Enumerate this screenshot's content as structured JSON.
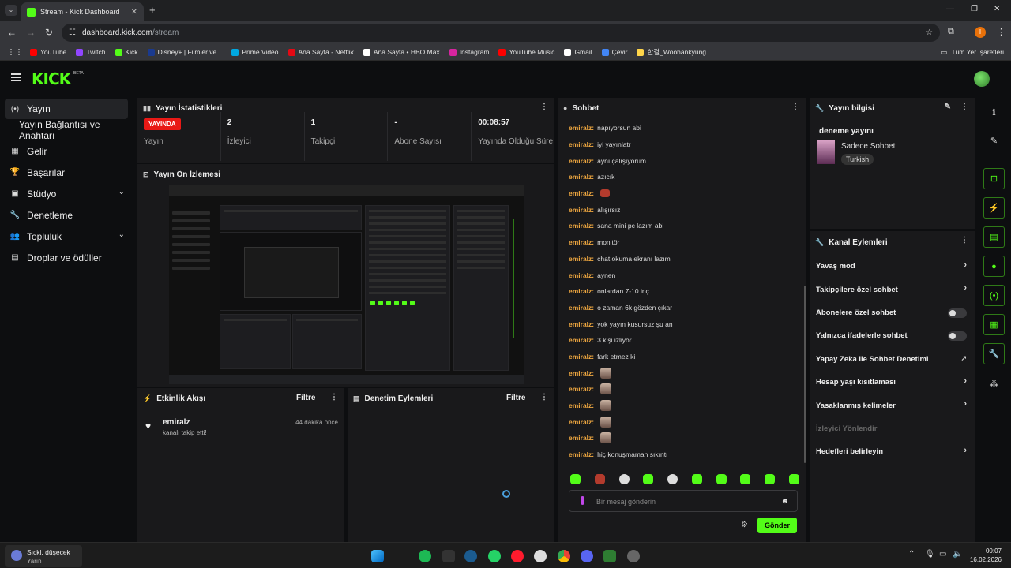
{
  "browser": {
    "tab_title": "Stream - Kick Dashboard",
    "url_host": "dashboard.kick.com",
    "url_path": "/stream",
    "profile_initial": "I",
    "bookmarks": [
      {
        "label": "YouTube",
        "color": "#ff0000"
      },
      {
        "label": "Twitch",
        "color": "#9146ff"
      },
      {
        "label": "Kick",
        "color": "#53fc18"
      },
      {
        "label": "Disney+ | Filmler ve...",
        "color": "#1a3a8f"
      },
      {
        "label": "Prime Video",
        "color": "#00a8e1"
      },
      {
        "label": "Ana Sayfa - Netflix",
        "color": "#e50914"
      },
      {
        "label": "Ana Sayfa • HBO Max",
        "color": "#ffffff"
      },
      {
        "label": "Instagram",
        "color": "#d6249f"
      },
      {
        "label": "YouTube Music",
        "color": "#ff0000"
      },
      {
        "label": "Gmail",
        "color": "#ffffff"
      },
      {
        "label": "Çevir",
        "color": "#4285f4"
      },
      {
        "label": "한결_Woohankyung...",
        "color": "#ffd54a"
      }
    ],
    "all_bookmarks": "Tüm Yer İşaretleri"
  },
  "app": {
    "logo": "KICK",
    "beta": "BETA"
  },
  "sidebar": {
    "items": [
      {
        "label": "Yayın",
        "icon": "(•)",
        "active": true
      },
      {
        "label": "Yayın Bağlantısı ve Anahtarı",
        "icon": ""
      },
      {
        "label": "Gelir",
        "icon": "▦"
      },
      {
        "label": "Başarılar",
        "icon": "🏆"
      },
      {
        "label": "Stüdyo",
        "icon": "▣",
        "chevron": true
      },
      {
        "label": "Denetleme",
        "icon": "🔧"
      },
      {
        "label": "Topluluk",
        "icon": "👥",
        "chevron": true
      },
      {
        "label": "Droplar ve ödüller",
        "icon": "▤"
      }
    ]
  },
  "stats": {
    "title": "Yayın İstatistikleri",
    "live_badge": "YAYINDA",
    "items": [
      {
        "value": "",
        "label": "Yayın"
      },
      {
        "value": "2",
        "label": "İzleyici"
      },
      {
        "value": "1",
        "label": "Takipçi"
      },
      {
        "value": "-",
        "label": "Abone Sayısı"
      },
      {
        "value": "00:08:57",
        "label": "Yayında Olduğu Süre"
      }
    ]
  },
  "preview": {
    "title": "Yayın Ön İzlemesi"
  },
  "activity": {
    "title": "Etkinlik Akışı",
    "filter": "Filtre",
    "items": [
      {
        "user": "emiralz",
        "desc": "kanalı takip etti!",
        "time": "44 dakika önce"
      }
    ]
  },
  "moderation": {
    "title": "Denetim Eylemleri",
    "filter": "Filtre"
  },
  "chat": {
    "title": "Sohbet",
    "messages": [
      {
        "user": "emiralz:",
        "text": "napıyorsun abi"
      },
      {
        "user": "emiralz:",
        "text": "iyi yayınlatr"
      },
      {
        "user": "emiralz:",
        "text": "aynı çalışıyorum"
      },
      {
        "user": "emiralz:",
        "text": "azıcık"
      },
      {
        "user": "emiralz:",
        "text": "",
        "emote": "red"
      },
      {
        "user": "emiralz:",
        "text": "alışırsız"
      },
      {
        "user": "emiralz:",
        "text": "sana mini pc lazım abi"
      },
      {
        "user": "emiralz:",
        "text": "monitör"
      },
      {
        "user": "emiralz:",
        "text": "chat okuma ekranı lazım"
      },
      {
        "user": "emiralz:",
        "text": "aynen"
      },
      {
        "user": "emiralz:",
        "text": "onlardan 7-10 inç"
      },
      {
        "user": "emiralz:",
        "text": "o zaman 6k gözden çıkar"
      },
      {
        "user": "emiralz:",
        "text": "yok yayın kusursuz şu an"
      },
      {
        "user": "emiralz:",
        "text": "3 kişi izliyor"
      },
      {
        "user": "emiralz:",
        "text": "fark etmez ki"
      },
      {
        "user": "emiralz:",
        "text": "",
        "emote": "face"
      },
      {
        "user": "emiralz:",
        "text": "",
        "emote": "face"
      },
      {
        "user": "emiralz:",
        "text": "",
        "emote": "face"
      },
      {
        "user": "emiralz:",
        "text": "",
        "emote": "face"
      },
      {
        "user": "emiralz:",
        "text": "",
        "emote": "face"
      },
      {
        "user": "emiralz:",
        "text": "hiç konuşmaman sıkıntı"
      }
    ],
    "input_placeholder": "Bir mesaj gönderin",
    "send_label": "Gönder"
  },
  "stream_info": {
    "title": "Yayın bilgisi",
    "stream_title": "deneme yayını",
    "category": "Sadece Sohbet",
    "tag": "Turkish"
  },
  "channel_actions": {
    "title": "Kanal Eylemleri",
    "items": [
      {
        "label": "Yavaş mod",
        "kind": "arrow"
      },
      {
        "label": "Takipçilere özel sohbet",
        "kind": "arrow"
      },
      {
        "label": "Abonelere özel sohbet",
        "kind": "toggle",
        "on": false
      },
      {
        "label": "Yalnızca ifadelerle sohbet",
        "kind": "toggle",
        "on": false
      },
      {
        "label": "Yapay Zeka ile Sohbet Denetimi",
        "kind": "external"
      },
      {
        "label": "Hesap yaşı kısıtlaması",
        "kind": "arrow"
      },
      {
        "label": "Yasaklanmış kelimeler",
        "kind": "arrow"
      },
      {
        "label": "İzleyici Yönlendir",
        "kind": "disabled"
      },
      {
        "label": "Hedefleri belirleyin",
        "kind": "arrow"
      }
    ]
  },
  "taskbar": {
    "weather_title": "Sıckl. düşecek",
    "weather_sub": "Yarın",
    "time": "00:07",
    "date": "16.02.2026"
  }
}
